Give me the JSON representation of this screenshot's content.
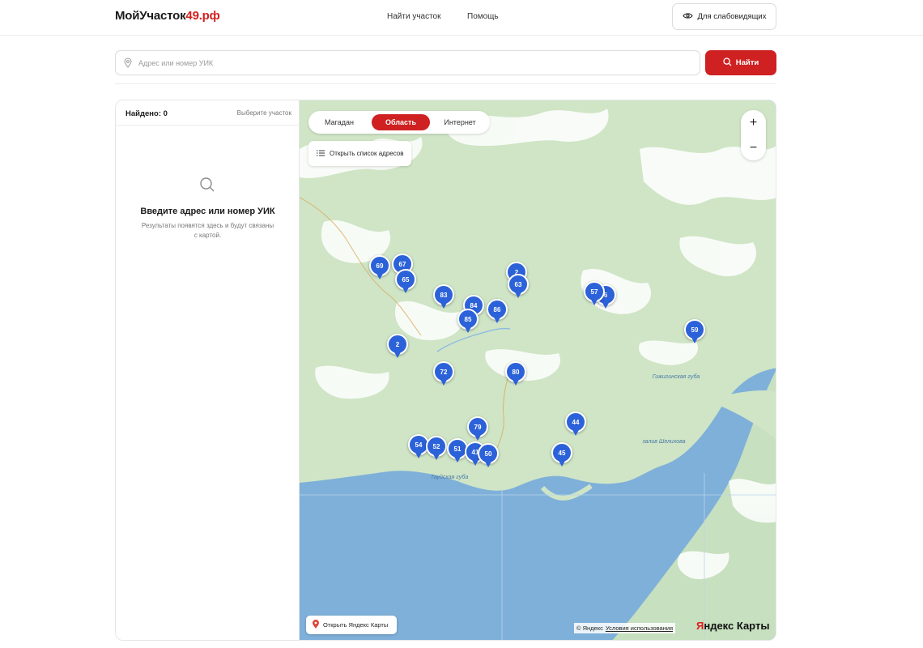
{
  "header": {
    "logo_main": "МойУчасток",
    "logo_accent": "49.рф",
    "nav": [
      "Найти участок",
      "Помощь"
    ],
    "accessibility_label": "Для слабовидящих"
  },
  "search": {
    "placeholder": "Адрес или номер УИК",
    "value": "",
    "button_label": "Найти"
  },
  "results": {
    "found_label": "Найдено: 0",
    "choose_label": "Выберите участок",
    "empty_title": "Введите адрес или номер УИК",
    "empty_subtitle": "Результаты появятся здесь и будут связаны с картой."
  },
  "map": {
    "tabs": [
      {
        "label": "Магадан",
        "active": false
      },
      {
        "label": "Область",
        "active": true
      },
      {
        "label": "Интернет",
        "active": false
      }
    ],
    "list_button_label": "Открыть список адресов",
    "zoom_in": "+",
    "zoom_out": "−",
    "open_yandex_label": "Открыть Яндекс Карты",
    "copyright": "© Яндекс",
    "terms": "Условия использования",
    "brand_y": "Я",
    "brand_rest": "ндекс Карты",
    "place_labels": [
      "Тауйская губа",
      "Гижигинская губа",
      "залив Шелихова"
    ],
    "markers": [
      "69",
      "67",
      "65",
      "2",
      "63",
      "83",
      "84",
      "86",
      "85",
      "57",
      "6",
      "59",
      "2",
      "72",
      "80",
      "79",
      "44",
      "54",
      "52",
      "51",
      "41",
      "50",
      "45"
    ],
    "colors": {
      "marker": "#2c62d9",
      "accent": "#cf2121",
      "sea": "#7fb0d9",
      "land": "#cfe5c6"
    }
  }
}
